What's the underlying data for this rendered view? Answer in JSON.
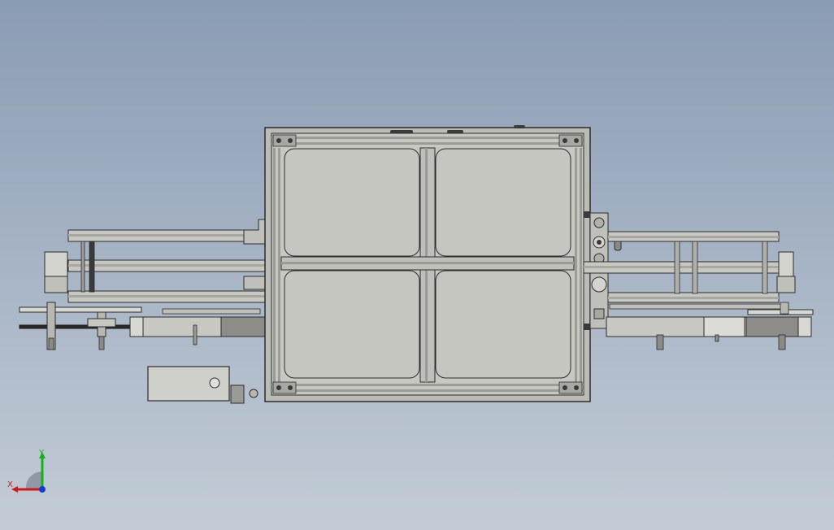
{
  "viewport": {
    "background_top": "#8a9cb4",
    "background_bottom": "#c3ccd6"
  },
  "model": {
    "colors": {
      "panel": "#c6c6c0",
      "frame": "#b8b8b2",
      "frame_light": "#d2d2cc",
      "edge": "#2c2c2c",
      "dark": "#4a4a4a",
      "metal": "#9a9a96"
    }
  },
  "triad": {
    "x_label": "X",
    "y_label": "Y",
    "x_color": "#d01818",
    "y_color": "#18b018",
    "z_color": "#1838d0"
  }
}
